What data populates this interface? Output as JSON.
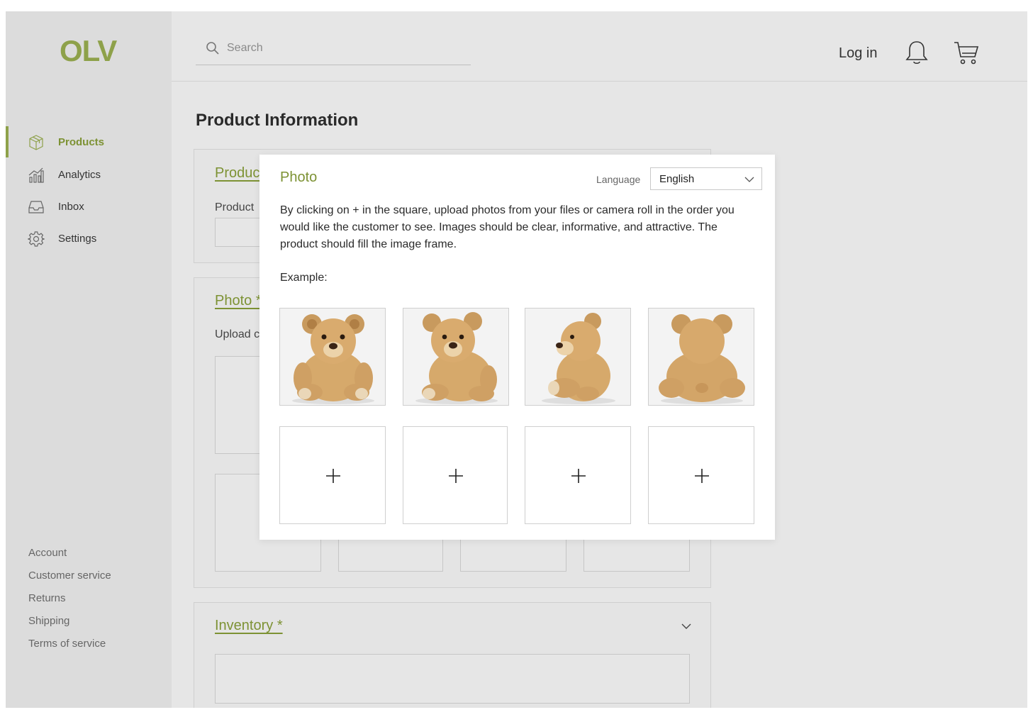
{
  "brand": {
    "logo": "OLV",
    "accent": "#8ea14a"
  },
  "sidebar": {
    "items": [
      {
        "label": "Products",
        "icon": "package-icon",
        "active": true
      },
      {
        "label": "Analytics",
        "icon": "chart-icon",
        "active": false
      },
      {
        "label": "Inbox",
        "icon": "inbox-icon",
        "active": false
      },
      {
        "label": "Settings",
        "icon": "gear-icon",
        "active": false
      }
    ],
    "footer": [
      "Account",
      "Customer service",
      "Returns",
      "Shipping",
      "Terms of service"
    ]
  },
  "header": {
    "search_placeholder": "Search",
    "login_label": "Log in",
    "icons": [
      "search-icon",
      "bell-icon",
      "cart-icon"
    ]
  },
  "main": {
    "title": "Product Information",
    "sections": {
      "product": {
        "title": "Produc",
        "field_label": "Product"
      },
      "photo": {
        "title": "Photo *",
        "hint": "Upload c"
      },
      "inventory": {
        "title": "Inventory *"
      }
    }
  },
  "modal": {
    "title": "Photo",
    "language_label": "Language",
    "language_value": "English",
    "description": "By clicking on + in the square, upload photos from your files or camera roll in the order you would like the customer to see. Images should be clear, informative, and attractive. The product should fill the image frame.",
    "example_label": "Example:",
    "examples": [
      "teddy bear front view",
      "teddy bear angled view",
      "teddy bear side view",
      "teddy bear back view"
    ],
    "upload_slots": 4
  }
}
